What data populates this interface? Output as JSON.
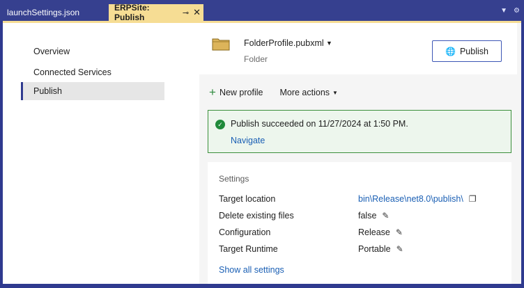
{
  "tabs": [
    {
      "label": "launchSettings.json",
      "active": false
    },
    {
      "label": "ERPSite: Publish",
      "active": true,
      "pin_icon": "pin-icon",
      "close_icon": "close-icon"
    }
  ],
  "window_controls": {
    "dropdown_icon": "chevron-down-icon",
    "settings_icon": "gear-icon"
  },
  "sidebar": {
    "items": [
      {
        "label": "Overview",
        "active": false
      },
      {
        "label": "Connected Services",
        "active": false
      },
      {
        "label": "Publish",
        "active": true
      }
    ]
  },
  "profile": {
    "name": "FolderProfile.pubxml",
    "type": "Folder",
    "icon": "folder-icon",
    "publish_label": "Publish"
  },
  "actions": {
    "new_profile": "New profile",
    "more_actions": "More actions"
  },
  "status": {
    "message": "Publish succeeded on 11/27/2024 at 1:50 PM.",
    "link": "Navigate",
    "color": "#1f8a3a"
  },
  "settings": {
    "title": "Settings",
    "rows": [
      {
        "label": "Target location",
        "value": "bin\\Release\\net8.0\\publish\\",
        "action": "copy-icon"
      },
      {
        "label": "Delete existing files",
        "value": "false",
        "action": "pencil-icon"
      },
      {
        "label": "Configuration",
        "value": "Release",
        "action": "pencil-icon"
      },
      {
        "label": "Target Runtime",
        "value": "Portable",
        "action": "pencil-icon"
      }
    ],
    "show_all": "Show all settings"
  },
  "colors": {
    "accent": "#2f3a8f",
    "active_tab": "#f6dd94",
    "link": "#1a5fb4",
    "success_border": "#3b8f3b"
  }
}
